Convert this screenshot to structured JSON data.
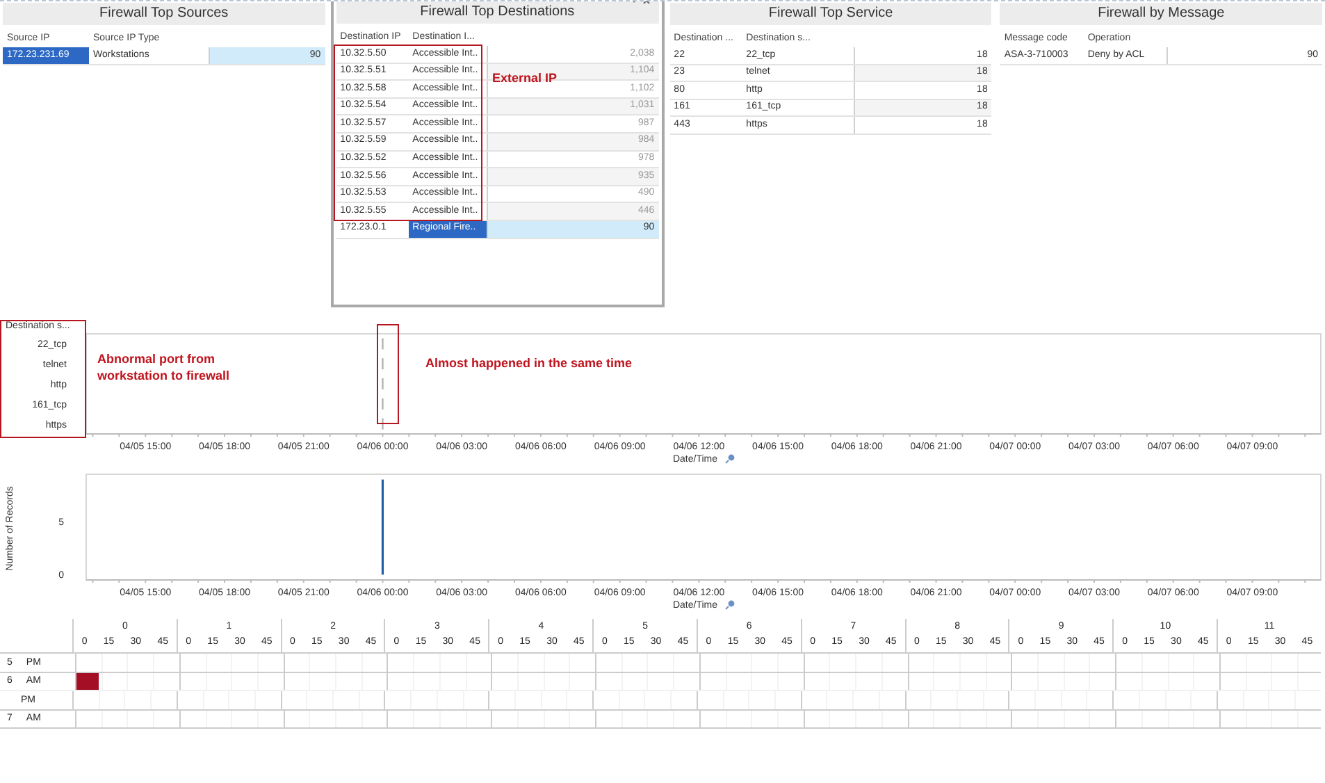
{
  "panels": [
    {
      "title": "Firewall Top Sources",
      "columns": [
        "Source IP",
        "Source IP Type"
      ],
      "rows": [
        {
          "cells": [
            {
              "text": "172.23.231.69",
              "selected": true
            },
            {
              "text": "Workstations",
              "selected": false
            }
          ],
          "count": "90",
          "level": 1,
          "dimmed": false
        }
      ]
    },
    {
      "title": "Firewall Top Destinations",
      "columns": [
        "Destination IP",
        "Destination I..."
      ],
      "rows": [
        {
          "cells": [
            {
              "text": "10.32.5.50",
              "selected": false
            },
            {
              "text": "Accessible Int..",
              "selected": false
            }
          ],
          "count": "2,038",
          "dimmed": true
        },
        {
          "cells": [
            {
              "text": "10.32.5.51",
              "selected": false
            },
            {
              "text": "Accessible Int..",
              "selected": false
            }
          ],
          "count": "1,104",
          "dimmed": true
        },
        {
          "cells": [
            {
              "text": "10.32.5.58",
              "selected": false
            },
            {
              "text": "Accessible Int..",
              "selected": false
            }
          ],
          "count": "1,102",
          "dimmed": true
        },
        {
          "cells": [
            {
              "text": "10.32.5.54",
              "selected": false
            },
            {
              "text": "Accessible Int..",
              "selected": false
            }
          ],
          "count": "1,031",
          "dimmed": true
        },
        {
          "cells": [
            {
              "text": "10.32.5.57",
              "selected": false
            },
            {
              "text": "Accessible Int..",
              "selected": false
            }
          ],
          "count": "987",
          "dimmed": true
        },
        {
          "cells": [
            {
              "text": "10.32.5.59",
              "selected": false
            },
            {
              "text": "Accessible Int..",
              "selected": false
            }
          ],
          "count": "984",
          "dimmed": true
        },
        {
          "cells": [
            {
              "text": "10.32.5.52",
              "selected": false
            },
            {
              "text": "Accessible Int..",
              "selected": false
            }
          ],
          "count": "978",
          "dimmed": true
        },
        {
          "cells": [
            {
              "text": "10.32.5.56",
              "selected": false
            },
            {
              "text": "Accessible Int..",
              "selected": false
            }
          ],
          "count": "935",
          "dimmed": true
        },
        {
          "cells": [
            {
              "text": "10.32.5.53",
              "selected": false
            },
            {
              "text": "Accessible Int..",
              "selected": false
            }
          ],
          "count": "490",
          "dimmed": true
        },
        {
          "cells": [
            {
              "text": "10.32.5.55",
              "selected": false
            },
            {
              "text": "Accessible Int..",
              "selected": false
            }
          ],
          "count": "446",
          "dimmed": true
        },
        {
          "cells": [
            {
              "text": "172.23.0.1",
              "selected": false
            },
            {
              "text": "Regional Fire..",
              "selected": true
            }
          ],
          "count": "90",
          "level": 1,
          "dimmed": false
        }
      ]
    },
    {
      "title": "Firewall Top Service",
      "columns": [
        "Destination ...",
        "Destination s..."
      ],
      "rows": [
        {
          "cells": [
            {
              "text": "22",
              "selected": false
            },
            {
              "text": "22_tcp",
              "selected": false
            }
          ],
          "count": "18",
          "dimmed": false
        },
        {
          "cells": [
            {
              "text": "23",
              "selected": false
            },
            {
              "text": "telnet",
              "selected": false
            }
          ],
          "count": "18",
          "dimmed": false
        },
        {
          "cells": [
            {
              "text": "80",
              "selected": false
            },
            {
              "text": "http",
              "selected": false
            }
          ],
          "count": "18",
          "dimmed": false
        },
        {
          "cells": [
            {
              "text": "161",
              "selected": false
            },
            {
              "text": "161_tcp",
              "selected": false
            }
          ],
          "count": "18",
          "dimmed": false
        },
        {
          "cells": [
            {
              "text": "443",
              "selected": false
            },
            {
              "text": "https",
              "selected": false
            }
          ],
          "count": "18",
          "dimmed": false
        }
      ]
    },
    {
      "title": "Firewall by Message",
      "columns": [
        "Message code",
        "Operation"
      ],
      "rows": [
        {
          "cells": [
            {
              "text": "ASA-3-710003",
              "selected": false
            },
            {
              "text": "Deny by ACL",
              "selected": false
            }
          ],
          "count": "90",
          "dimmed": false
        }
      ]
    }
  ],
  "timeline": {
    "row_header": "Destination s...",
    "axis_title": "Date/Time",
    "time_labels": [
      "04/05 15:00",
      "04/05 18:00",
      "04/05 21:00",
      "04/06 00:00",
      "04/06 03:00",
      "04/06 06:00",
      "04/06 09:00",
      "04/06 12:00",
      "04/06 15:00",
      "04/06 18:00",
      "04/06 21:00",
      "04/07 00:00",
      "04/07 03:00",
      "04/07 06:00",
      "04/07 09:00"
    ],
    "rows": [
      {
        "label": "22_tcp",
        "event": true
      },
      {
        "label": "telnet",
        "event": true
      },
      {
        "label": "http",
        "event": true
      },
      {
        "label": "161_tcp",
        "event": true
      },
      {
        "label": "https",
        "event": true
      }
    ]
  },
  "records": {
    "chart_data": {
      "type": "bar",
      "xlabel": "Date/Time",
      "ylabel": "Number of Records",
      "categories": [
        "04/05 15:00",
        "04/05 18:00",
        "04/05 21:00",
        "04/06 00:00",
        "04/06 03:00",
        "04/06 06:00",
        "04/06 09:00",
        "04/06 12:00",
        "04/06 15:00",
        "04/06 18:00",
        "04/06 21:00",
        "04/07 00:00",
        "04/07 03:00",
        "04/07 06:00",
        "04/07 09:00"
      ],
      "series": [
        {
          "color": "#1f5fa8",
          "values": [
            null,
            null,
            null,
            9,
            null,
            null,
            null,
            null,
            null,
            null,
            null,
            null,
            null,
            null,
            null
          ]
        }
      ],
      "ylim": [
        -0.5,
        9.5
      ],
      "yticks": [
        0,
        5
      ]
    }
  },
  "heatmap": {
    "hours": [
      {
        "label": "0",
        "minutes": [
          "0",
          "15",
          "30",
          "45"
        ]
      },
      {
        "label": "1",
        "minutes": [
          "0",
          "15",
          "30",
          "45"
        ]
      },
      {
        "label": "2",
        "minutes": [
          "0",
          "15",
          "30",
          "45"
        ]
      },
      {
        "label": "3",
        "minutes": [
          "0",
          "15",
          "30",
          "45"
        ]
      },
      {
        "label": "4",
        "minutes": [
          "0",
          "15",
          "30",
          "45"
        ]
      },
      {
        "label": "5",
        "minutes": [
          "0",
          "15",
          "30",
          "45"
        ]
      },
      {
        "label": "6",
        "minutes": [
          "0",
          "15",
          "30",
          "45"
        ]
      },
      {
        "label": "7",
        "minutes": [
          "0",
          "15",
          "30",
          "45"
        ]
      },
      {
        "label": "8",
        "minutes": [
          "0",
          "15",
          "30",
          "45"
        ]
      },
      {
        "label": "9",
        "minutes": [
          "0",
          "15",
          "30",
          "45"
        ]
      },
      {
        "label": "10",
        "minutes": [
          "0",
          "15",
          "30",
          "45"
        ]
      },
      {
        "label": "11",
        "minutes": [
          "0",
          "15",
          "30",
          "45"
        ]
      }
    ],
    "rows": [
      {
        "day": "5",
        "period": "PM",
        "filled": [
          false,
          false,
          false,
          false,
          false,
          false,
          false,
          false,
          false,
          false,
          false,
          false,
          false,
          false,
          false,
          false,
          false,
          false,
          false,
          false,
          false,
          false,
          false,
          false,
          false,
          false,
          false,
          false,
          false,
          false,
          false,
          false,
          false,
          false,
          false,
          false,
          false,
          false,
          false,
          false,
          false,
          false,
          false,
          false,
          false,
          false,
          false,
          false
        ]
      },
      {
        "day": "6",
        "period": "AM",
        "filled": [
          true,
          false,
          false,
          false,
          false,
          false,
          false,
          false,
          false,
          false,
          false,
          false,
          false,
          false,
          false,
          false,
          false,
          false,
          false,
          false,
          false,
          false,
          false,
          false,
          false,
          false,
          false,
          false,
          false,
          false,
          false,
          false,
          false,
          false,
          false,
          false,
          false,
          false,
          false,
          false,
          false,
          false,
          false,
          false,
          false,
          false,
          false,
          false
        ]
      },
      {
        "period": "PM",
        "filled": [
          false,
          false,
          false,
          false,
          false,
          false,
          false,
          false,
          false,
          false,
          false,
          false,
          false,
          false,
          false,
          false,
          false,
          false,
          false,
          false,
          false,
          false,
          false,
          false,
          false,
          false,
          false,
          false,
          false,
          false,
          false,
          false,
          false,
          false,
          false,
          false,
          false,
          false,
          false,
          false,
          false,
          false,
          false,
          false,
          false,
          false,
          false,
          false
        ]
      },
      {
        "day": "7",
        "period": "AM",
        "filled": [
          false,
          false,
          false,
          false,
          false,
          false,
          false,
          false,
          false,
          false,
          false,
          false,
          false,
          false,
          false,
          false,
          false,
          false,
          false,
          false,
          false,
          false,
          false,
          false,
          false,
          false,
          false,
          false,
          false,
          false,
          false,
          false,
          false,
          false,
          false,
          false,
          false,
          false,
          false,
          false,
          false,
          false,
          false,
          false,
          false,
          false,
          false,
          false
        ]
      }
    ]
  },
  "annotations": [
    {
      "text": "External IP"
    },
    {
      "text": "Abnormal port from workstation to firewall"
    },
    {
      "text": "Almost happened in the same time"
    }
  ]
}
